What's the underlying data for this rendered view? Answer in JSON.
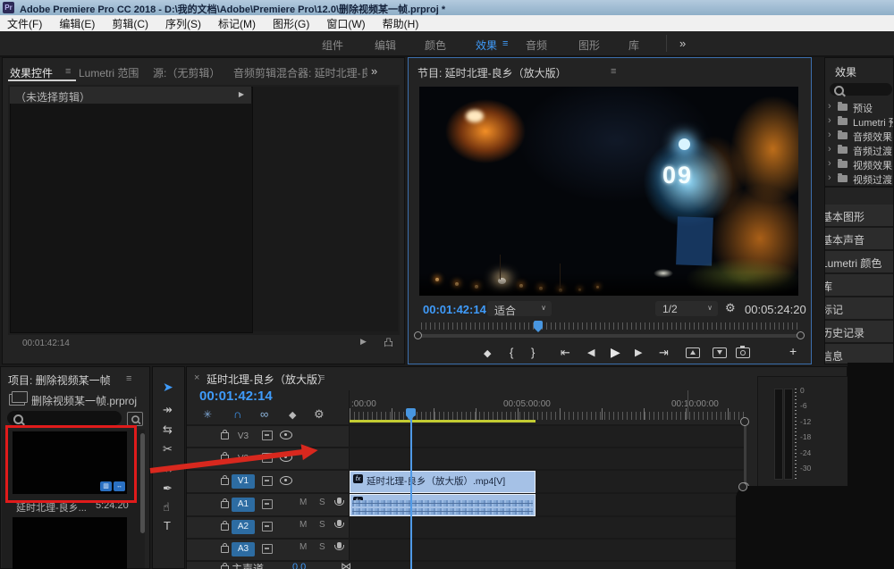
{
  "titlebar": {
    "icon": "Pr",
    "title": "Adobe Premiere Pro CC 2018 - D:\\我的文档\\Adobe\\Premiere Pro\\12.0\\删除视频某一帧.prproj *"
  },
  "menubar": {
    "items": [
      {
        "label": "文件(F)"
      },
      {
        "label": "编辑(E)"
      },
      {
        "label": "剪辑(C)"
      },
      {
        "label": "序列(S)"
      },
      {
        "label": "标记(M)"
      },
      {
        "label": "图形(G)"
      },
      {
        "label": "窗口(W)"
      },
      {
        "label": "帮助(H)"
      }
    ]
  },
  "workspace": {
    "tabs": [
      {
        "label": "组件"
      },
      {
        "label": "编辑"
      },
      {
        "label": "颜色"
      },
      {
        "label": "效果"
      },
      {
        "label": "音频"
      },
      {
        "label": "图形"
      },
      {
        "label": "库"
      }
    ],
    "active": "效果",
    "menu_icon": "≡",
    "overflow_icon": "»"
  },
  "effect_controls": {
    "tabs": [
      {
        "label": "效果控件"
      },
      {
        "label": "Lumetri 范围"
      },
      {
        "label": "源:（无剪辑）"
      },
      {
        "label": "音频剪辑混合器: 延时北理-良乡（）"
      }
    ],
    "menu_icon": "≡",
    "overflow_icon": "»",
    "empty_text": "（未选择剪辑）",
    "expand_icon": "▶",
    "timecode": "00:01:42:14",
    "play_audio_icon": "▶",
    "export_icon": "凸"
  },
  "program": {
    "title": "节目: 延时北理-良乡（放大版）",
    "menu_icon": "≡",
    "timecode": "00:01:42:14",
    "duration": "00:05:24:20",
    "fit_label": "适合",
    "zoom_label": "1/2",
    "chevron": "∨",
    "settings_icon": "⚙",
    "video_countdown": "09",
    "transport": {
      "marker": "◆",
      "mark_in": "{",
      "mark_out": "}",
      "goto_in": "⇤",
      "step_back": "◀",
      "play": "▶",
      "step_fwd": "▶",
      "goto_out": "⇥",
      "plus": "+"
    }
  },
  "effects_panel": {
    "title": "效果",
    "chevron": "›",
    "tree": [
      {
        "label": "预设"
      },
      {
        "label": "Lumetri 预设"
      },
      {
        "label": "音频效果"
      },
      {
        "label": "音频过渡"
      },
      {
        "label": "视频效果"
      },
      {
        "label": "视频过渡"
      }
    ]
  },
  "stacked_panels": {
    "items": [
      {
        "label": "基本图形"
      },
      {
        "label": "基本声音"
      },
      {
        "label": "Lumetri 颜色"
      },
      {
        "label": "库"
      },
      {
        "label": "标记"
      },
      {
        "label": "历史记录"
      },
      {
        "label": "信息"
      }
    ]
  },
  "project": {
    "title": "项目: 删除视频某一帧",
    "menu_icon": "≡",
    "file": "删除视频某一帧.prproj",
    "item_name": "延时北理-良乡...",
    "item_duration": "5:24.20"
  },
  "tools": {
    "items": [
      {
        "glyph": "➤"
      },
      {
        "glyph": "↠"
      },
      {
        "glyph": "⇆"
      },
      {
        "glyph": "✂"
      },
      {
        "glyph": "↔"
      },
      {
        "glyph": "✒"
      },
      {
        "glyph": "☝"
      },
      {
        "glyph": "T"
      }
    ]
  },
  "timeline": {
    "close_icon": "×",
    "title": "延时北理-良乡（放大版）",
    "menu_icon": "≡",
    "timecode": "00:01:42:14",
    "nest_icon": "✳",
    "snap_icon": "∩",
    "link_icon": "∞",
    "marker_icon": "◆",
    "settings_icon": "⚙",
    "ruler": [
      {
        "label": ":00:00"
      },
      {
        "label": "00:05:00:00"
      },
      {
        "label": "00:10:00:00"
      }
    ],
    "video_tracks": [
      {
        "name": "V3"
      },
      {
        "name": "V2"
      },
      {
        "name": "V1"
      }
    ],
    "audio_tracks": [
      {
        "name": "A1"
      },
      {
        "name": "A2"
      },
      {
        "name": "A3"
      }
    ],
    "mute": "M",
    "solo": "S",
    "master_label": "主声道",
    "master_level": "0.0",
    "master_icon": "⋈",
    "fx_badge": "fx",
    "clip_label": "延时北理-良乡（放大版）.mp4[V]",
    "meter_ticks": [
      {
        "label": "0"
      },
      {
        "label": "-6"
      },
      {
        "label": "-12"
      },
      {
        "label": "-18"
      },
      {
        "label": "-24"
      },
      {
        "label": "-30"
      }
    ]
  },
  "colors": {
    "accent_blue": "#3f9bfa",
    "clip_blue": "#a5c1e6",
    "workarea_yellow": "#c3cc32",
    "annotation_red": "#d8281e",
    "highlight_red": "#e01b1b"
  }
}
